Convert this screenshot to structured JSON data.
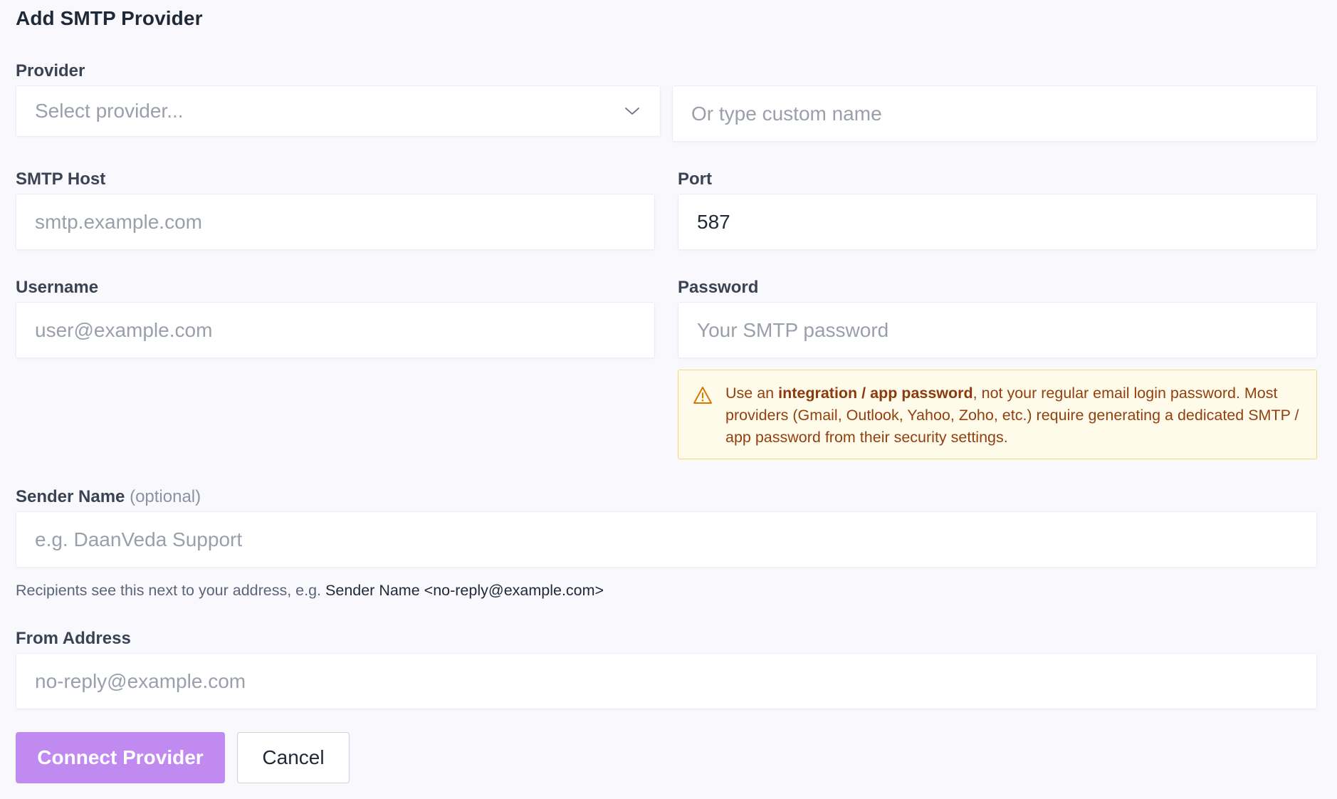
{
  "page": {
    "title": "Add SMTP Provider"
  },
  "provider": {
    "label": "Provider",
    "select_placeholder": "Select provider...",
    "custom_placeholder": "Or type custom name"
  },
  "smtp_host": {
    "label": "SMTP Host",
    "placeholder": "smtp.example.com",
    "value": ""
  },
  "port": {
    "label": "Port",
    "value": "587"
  },
  "username": {
    "label": "Username",
    "placeholder": "user@example.com",
    "value": ""
  },
  "password": {
    "label": "Password",
    "placeholder": "Your SMTP password",
    "value": ""
  },
  "warning": {
    "icon": "warning-triangle-icon",
    "text_prefix": "Use an ",
    "text_bold": "integration / app password",
    "text_suffix": ", not your regular email login password. Most providers (Gmail, Outlook, Yahoo, Zoho, etc.) require generating a dedicated SMTP / app password from their security settings.",
    "color_text": "#92400e",
    "color_bg": "#fffbeb",
    "color_border": "#f6d77a"
  },
  "sender_name": {
    "label": "Sender Name",
    "label_optional": "(optional)",
    "placeholder": "e.g. DaanVeda Support",
    "hint_prefix": "Recipients see this next to your address, e.g. ",
    "hint_example": "Sender Name <no-reply@example.com>"
  },
  "from_address": {
    "label": "From Address",
    "placeholder": "no-reply@example.com"
  },
  "actions": {
    "connect_label": "Connect Provider",
    "cancel_label": "Cancel",
    "accent_color": "#c18af0"
  }
}
